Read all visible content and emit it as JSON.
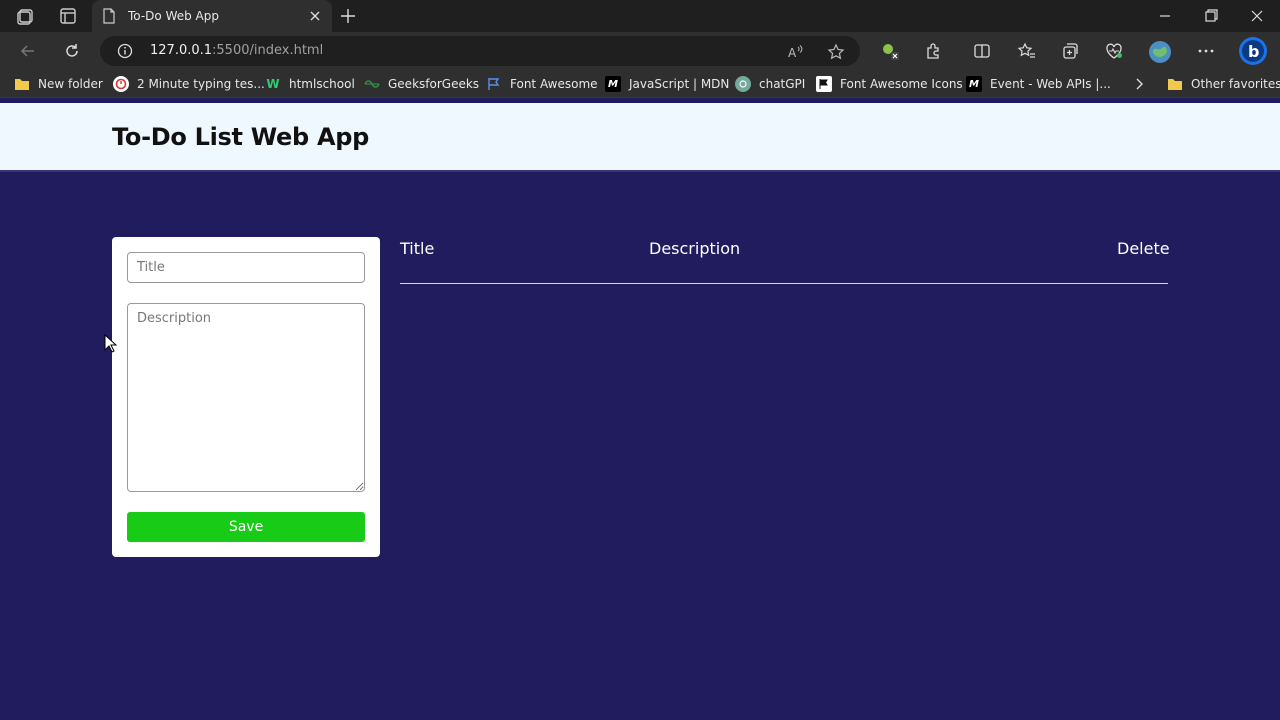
{
  "browser": {
    "tab_title": "To-Do Web App",
    "url_host": "127.0.0.1",
    "url_path": ":5500/index.html",
    "bookmarks": [
      {
        "label": "New folder",
        "icon": "folder-icon"
      },
      {
        "label": "2 Minute typing tes...",
        "icon": "typing-test-icon"
      },
      {
        "label": "htmlschool",
        "icon": "htmlschool-icon"
      },
      {
        "label": "GeeksforGeeks",
        "icon": "geeksforgeeks-icon"
      },
      {
        "label": "Font Awesome",
        "icon": "flag-icon"
      },
      {
        "label": "JavaScript | MDN",
        "icon": "mdn-icon"
      },
      {
        "label": "chatGPI",
        "icon": "chatgpt-icon"
      },
      {
        "label": "Font Awesome Icons",
        "icon": "flag-icon"
      },
      {
        "label": "Event - Web APIs |...",
        "icon": "mdn-icon"
      }
    ],
    "other_favorites": "Other favorites"
  },
  "header": {
    "title": "To-Do List Web App"
  },
  "form": {
    "title_placeholder": "Title",
    "description_placeholder": "Description",
    "save_label": "Save"
  },
  "table": {
    "headers": [
      "Title",
      "Description",
      "Delete"
    ]
  },
  "colors": {
    "page_bg": "#211c5d",
    "header_bg": "#f0f8ff",
    "save_button": "#17cb17"
  }
}
